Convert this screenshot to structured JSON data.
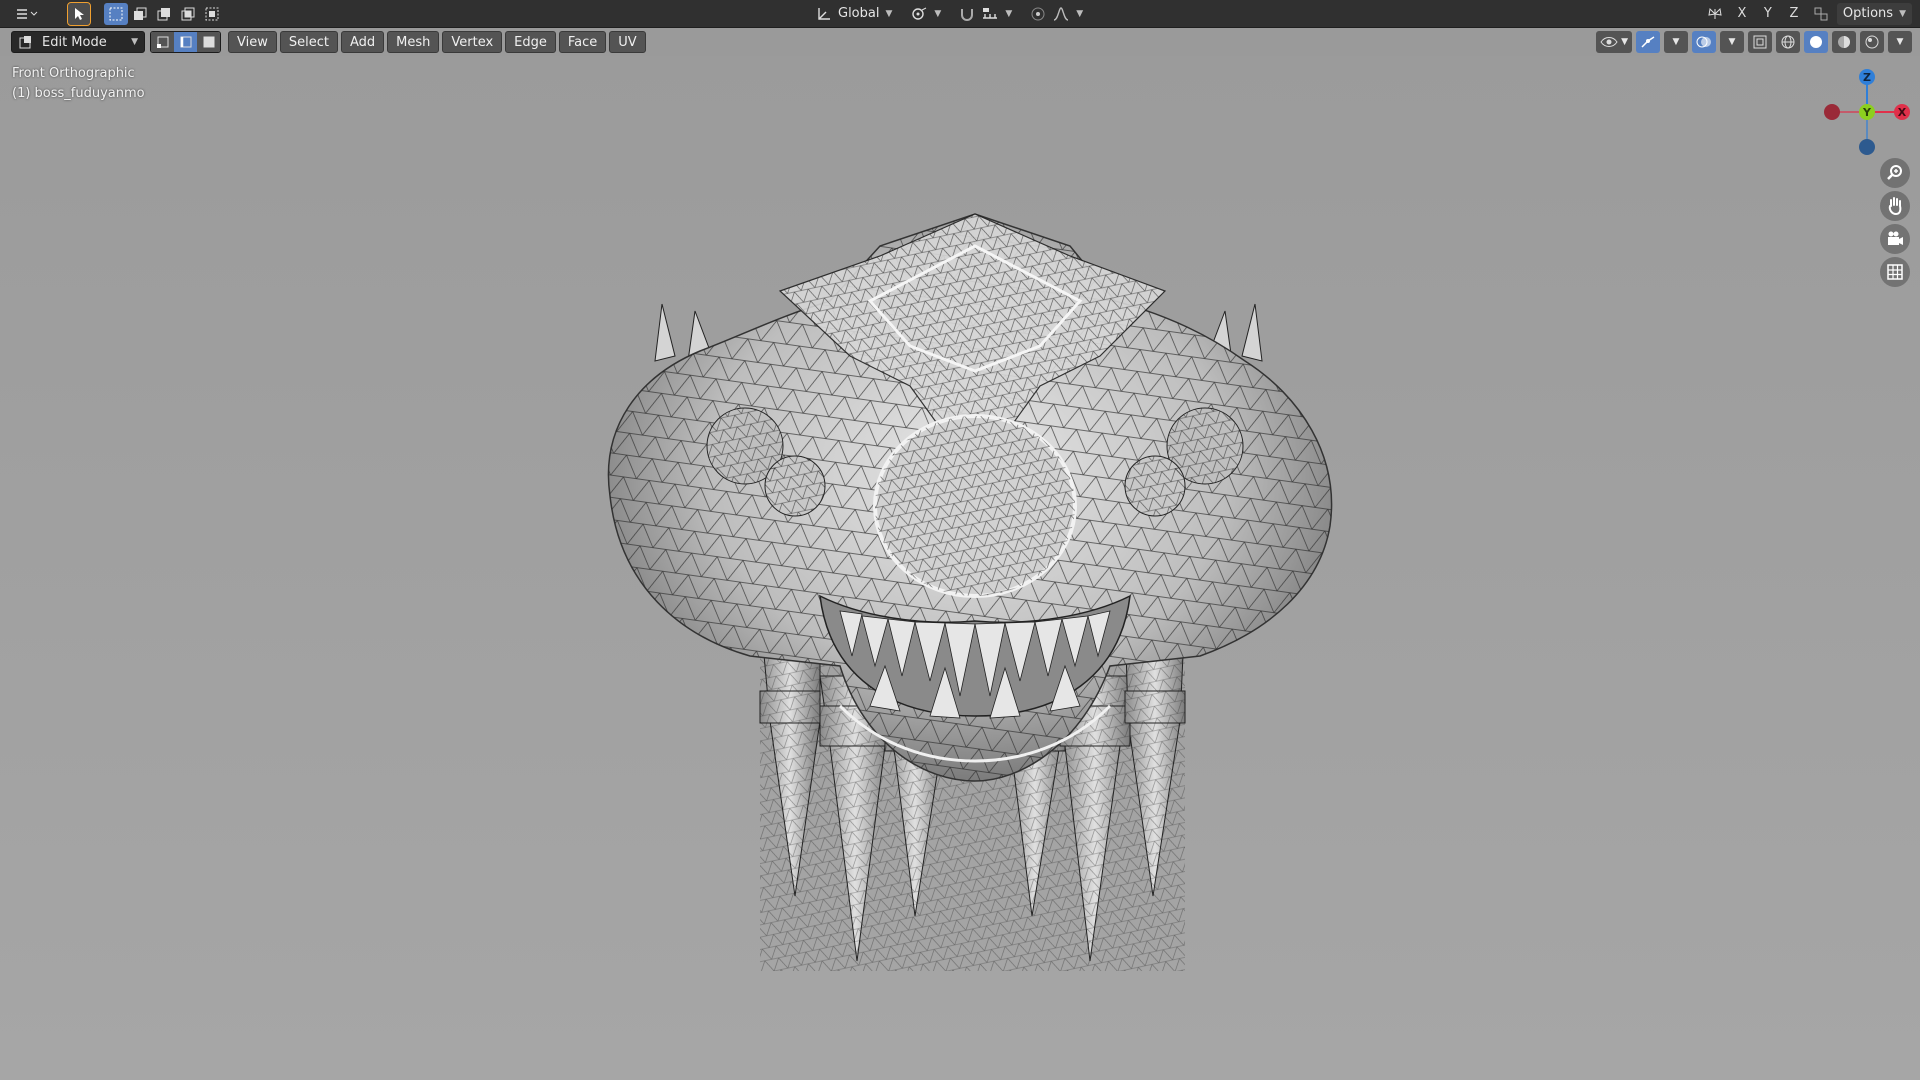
{
  "header": {
    "transform_orientation": "Global",
    "axis_x": "X",
    "axis_y": "Y",
    "axis_z": "Z",
    "options_label": "Options"
  },
  "viewport_header": {
    "mode_label": "Edit Mode",
    "menus": [
      "View",
      "Select",
      "Add",
      "Mesh",
      "Vertex",
      "Edge",
      "Face",
      "UV"
    ]
  },
  "viewport": {
    "view_name": "Front Orthographic",
    "object_name": "(1) boss_fuduyanmo"
  },
  "gizmo": {
    "z_label": "Z",
    "y_label": "Y",
    "x_label": "X",
    "colors": {
      "x": "#e0304a",
      "y": "#8ccf1f",
      "z": "#2f7fd9"
    }
  }
}
